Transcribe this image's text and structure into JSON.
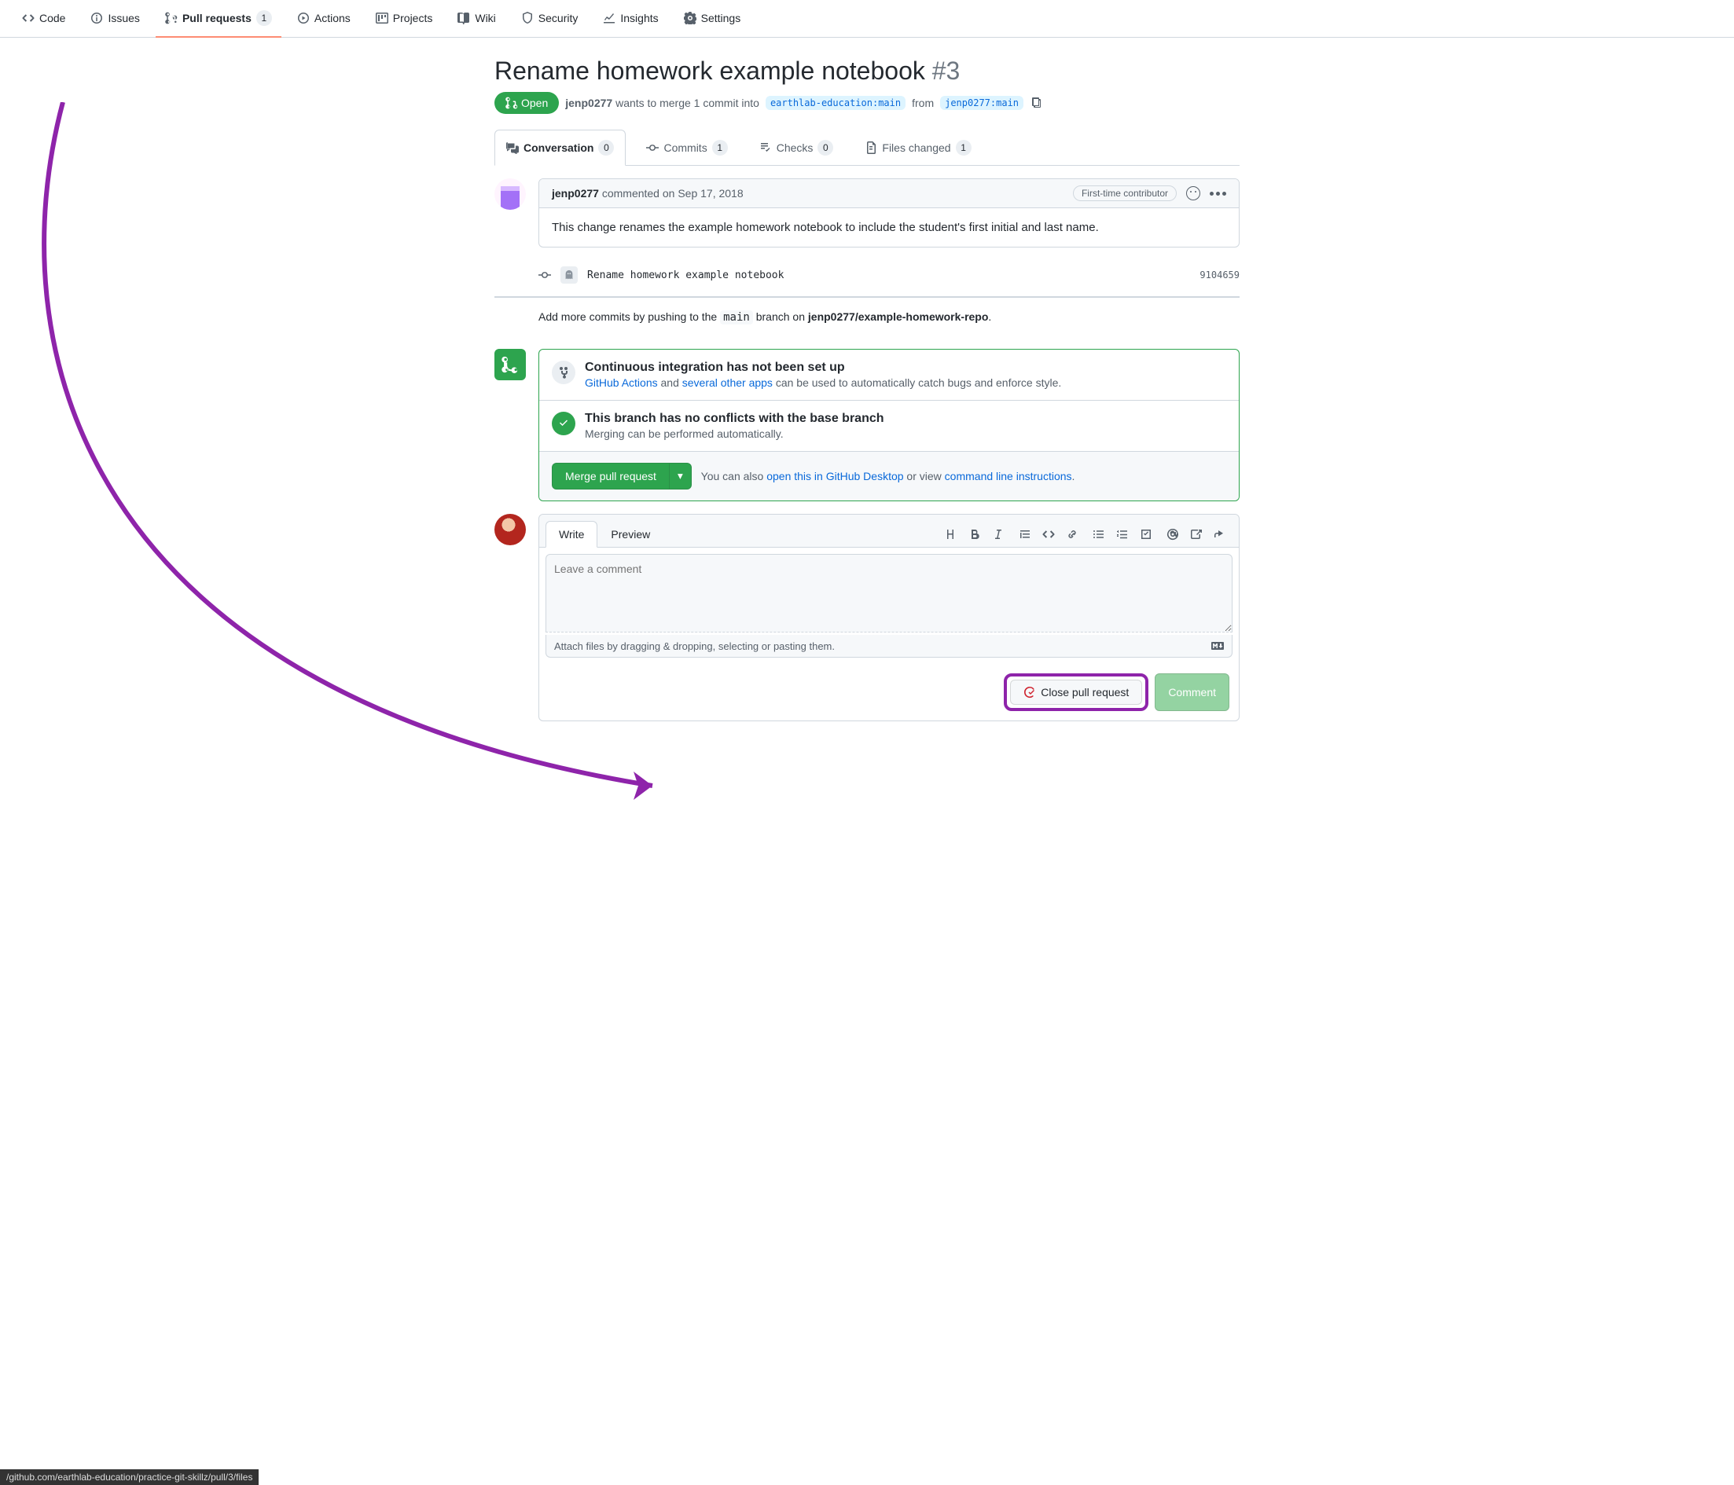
{
  "repo_nav": {
    "code": "Code",
    "issues": "Issues",
    "pull_requests": "Pull requests",
    "pull_requests_count": "1",
    "actions": "Actions",
    "projects": "Projects",
    "wiki": "Wiki",
    "security": "Security",
    "insights": "Insights",
    "settings": "Settings"
  },
  "pr": {
    "title": "Rename homework example notebook",
    "number": "#3",
    "state": "Open",
    "author": "jenp0277",
    "merge_text": "wants to merge 1 commit into",
    "base_branch": "earthlab-education:main",
    "from_text": "from",
    "head_branch": "jenp0277:main"
  },
  "pr_tabs": {
    "conversation": "Conversation",
    "conversation_count": "0",
    "commits": "Commits",
    "commits_count": "1",
    "checks": "Checks",
    "checks_count": "0",
    "files": "Files changed",
    "files_count": "1"
  },
  "comment": {
    "author": "jenp0277",
    "action": "commented",
    "time": "on Sep 17, 2018",
    "badge": "First-time contributor",
    "body": "This change renames the example homework notebook to include the student's first initial and last name."
  },
  "commit": {
    "message": "Rename homework example notebook",
    "sha": "9104659"
  },
  "push_hint": {
    "prefix": "Add more commits by pushing to the ",
    "branch": "main",
    "mid": " branch on ",
    "repo": "jenp0277/example-homework-repo",
    "suffix": "."
  },
  "merge_panel": {
    "ci_title": "Continuous integration has not been set up",
    "ci_link1": "GitHub Actions",
    "ci_mid": " and ",
    "ci_link2": "several other apps",
    "ci_tail": " can be used to automatically catch bugs and enforce style.",
    "conflict_title": "This branch has no conflicts with the base branch",
    "conflict_sub": "Merging can be performed automatically.",
    "merge_btn": "Merge pull request",
    "aside_prefix": "You can also ",
    "aside_link1": "open this in GitHub Desktop",
    "aside_mid": " or view ",
    "aside_link2": "command line instructions",
    "aside_suffix": "."
  },
  "form": {
    "tab_write": "Write",
    "tab_preview": "Preview",
    "placeholder": "Leave a comment",
    "attach_hint": "Attach files by dragging & dropping, selecting or pasting them.",
    "close_btn": "Close pull request",
    "comment_btn": "Comment"
  },
  "status_bar": "/github.com/earthlab-education/practice-git-skillz/pull/3/files"
}
